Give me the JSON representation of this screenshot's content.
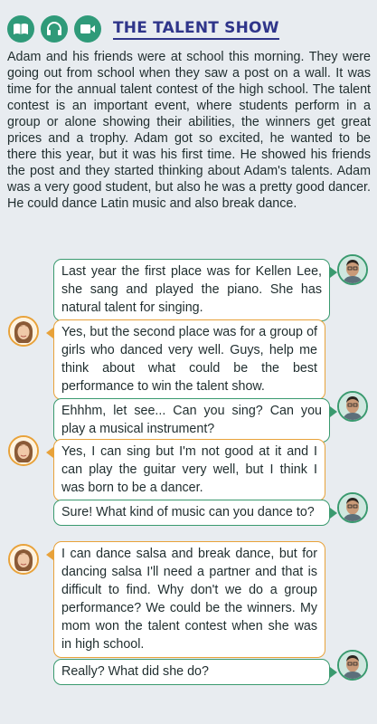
{
  "header": {
    "icons": [
      "book-icon",
      "headphones-icon",
      "video-camera-icon"
    ],
    "title": "THE TALENT SHOW"
  },
  "story": "Adam and his friends were at school this morning. They were going out from school when they saw a post on a wall. It was time for the annual talent contest of the high school. The talent contest is an important event, where students perform in a group or alone showing their abilities, the winners get great prices and a trophy. Adam got so excited, he wanted to be there this year, but it was his first time. He showed his friends the post and they started thinking about Adam's talents. Adam was a very good student, but also he was a pretty good dancer. He could dance Latin music and also break dance.",
  "dialogue": [
    {
      "speaker": "boy",
      "text": "Last year the first place was for Kellen Lee, she sang and played the piano. She has natural talent for singing."
    },
    {
      "speaker": "girl",
      "text": "Yes, but the second place was for a group of girls who danced very well. Guys, help me think about what could be the best performance to win the talent show."
    },
    {
      "speaker": "boy",
      "text": "Ehhhm, let see... Can you sing? Can you play a musical instrument?"
    },
    {
      "speaker": "girl",
      "text": "Yes, I can sing but I'm not good at it and I can play the guitar very well, but I think I was born to be a dancer."
    },
    {
      "speaker": "boy",
      "text": "Sure! What kind of music can you dance to?"
    },
    {
      "speaker": "girl",
      "text": "I can dance salsa and break dance, but for dancing salsa I'll need a partner and that is difficult to find. Why don't we do a group performance? We could be the winners. My mom won the talent contest when she was in high school."
    },
    {
      "speaker": "boy",
      "text": "Really? What did she do?"
    }
  ],
  "colors": {
    "title": "#2f358a",
    "icon_bg": "#2f9a79",
    "boy_border": "#3a9a6f",
    "girl_border": "#e8a23a",
    "background": "#e8ecf0"
  }
}
